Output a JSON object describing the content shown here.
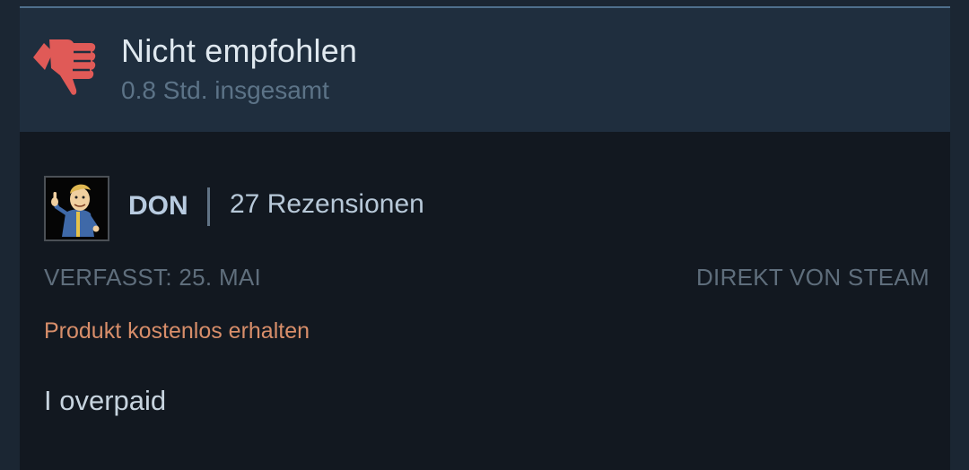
{
  "review": {
    "verdict": "Nicht empfohlen",
    "verdict_icon": "thumbs-down-icon",
    "playtime": "0.8 Std. insgesamt",
    "author": {
      "name": "DON",
      "review_count": "27 Rezensionen",
      "avatar": "vault-boy-avatar"
    },
    "posted": "VERFASST: 25. MAI",
    "source": "DIREKT VON STEAM",
    "product_note": "Produkt kostenlos erhalten",
    "text": "I overpaid"
  },
  "colors": {
    "background": "#121820",
    "header": "#1f2e3e",
    "thumb_down": "#e05a57",
    "free_product": "#d88e6a"
  }
}
